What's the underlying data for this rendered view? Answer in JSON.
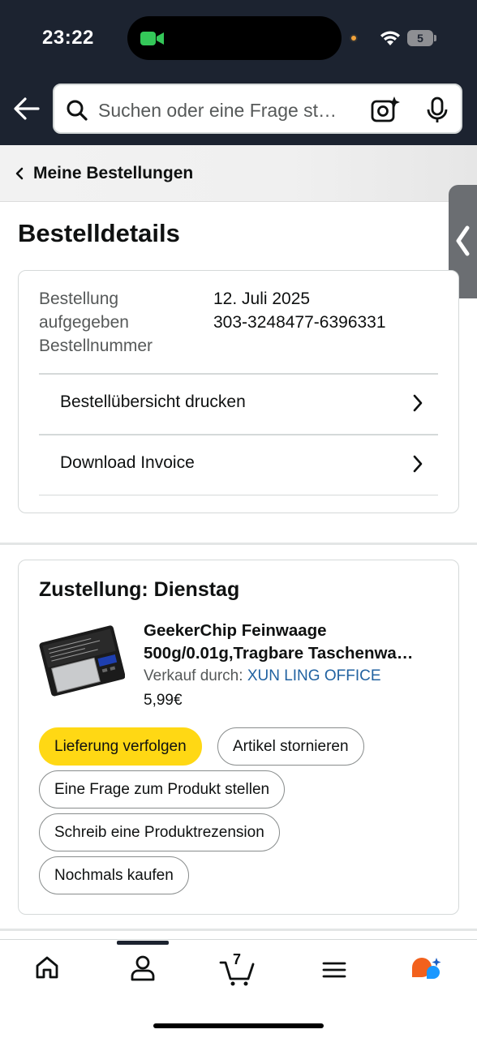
{
  "status_bar": {
    "time": "23:22",
    "battery": "5"
  },
  "search": {
    "placeholder": "Suchen oder eine Frage st…"
  },
  "breadcrumb": {
    "label": "Meine Bestellungen"
  },
  "page": {
    "title": "Bestelldetails"
  },
  "order": {
    "placed_label_1": "Bestellung",
    "placed_label_2": "aufgegeben",
    "number_label": "Bestellnummer",
    "date": "12. Juli 2025",
    "number": "303-3248477-6396331",
    "links": [
      {
        "label": "Bestellübersicht drucken"
      },
      {
        "label": "Download Invoice"
      }
    ]
  },
  "delivery": {
    "title": "Zustellung: Dienstag",
    "product": {
      "name_line1": "GeekerChip Feinwaage",
      "name_line2": "500g/0.01g,Tragbare Taschenwa…",
      "seller_prefix": "Verkauf durch:",
      "seller_name": "XUN LING OFFICE",
      "price": "5,99€"
    },
    "buttons": {
      "track": "Lieferung verfolgen",
      "cancel": "Artikel stornieren",
      "question": "Eine Frage zum Produkt stellen",
      "review": "Schreib eine Produktrezension",
      "rebuy": "Nochmals kaufen"
    }
  },
  "bottom_nav": {
    "cart_count": "7",
    "items": [
      "home-icon",
      "account-icon",
      "cart-icon",
      "menu-icon",
      "rufus-icon"
    ]
  },
  "colors": {
    "header_bg": "#1c2330",
    "primary_button": "#ffd814",
    "link": "#2162a1"
  }
}
